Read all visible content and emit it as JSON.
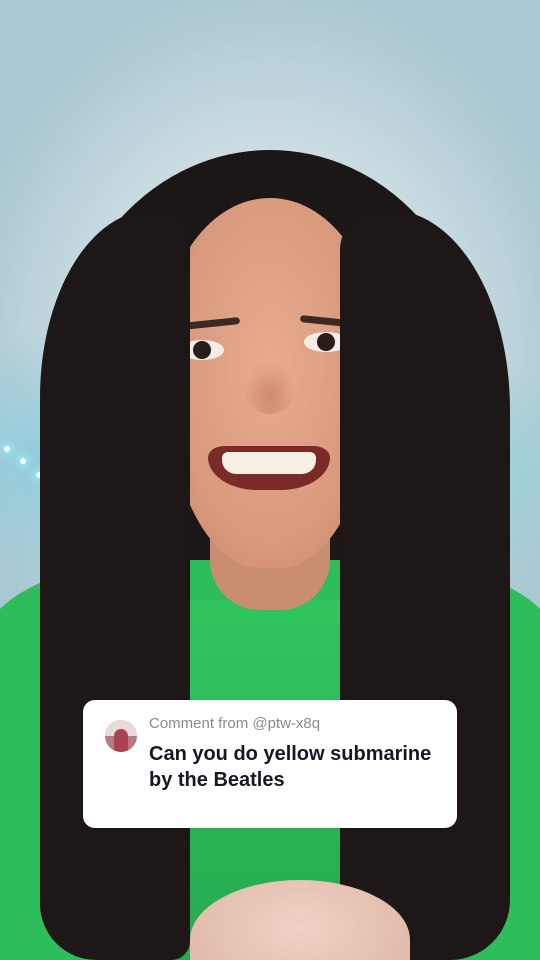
{
  "comment_card": {
    "meta": "Comment from @ptw-x8q",
    "text": "Can you do yellow submarine by the Beatles",
    "background_color": "#ffffff",
    "text_color": "#161823",
    "meta_color": "#8a8a8e"
  },
  "icons": {
    "avatar": "commenter-avatar"
  }
}
